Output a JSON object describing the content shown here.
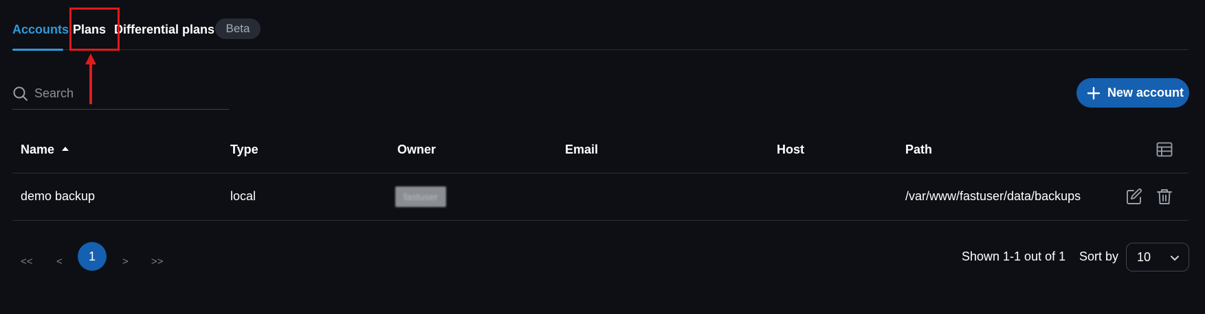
{
  "tabs": [
    {
      "label": "Accounts",
      "active": true
    },
    {
      "label": "Plans",
      "active": false
    },
    {
      "label": "Differential plans",
      "active": false
    }
  ],
  "beta_badge": "Beta",
  "search": {
    "placeholder": "Search",
    "value": ""
  },
  "new_button": {
    "label": "New account",
    "icon": "plus-icon"
  },
  "table": {
    "columns": [
      "Name",
      "Type",
      "Owner",
      "Email",
      "Host",
      "Path"
    ],
    "sort_column": "Name",
    "sort_direction": "ascending",
    "rows": [
      {
        "name": "demo backup",
        "type": "local",
        "owner": "fastuser",
        "email": "",
        "host": "",
        "path": "/var/www/fastuser/data/backups"
      }
    ]
  },
  "pagination": {
    "first": "<<",
    "prev": "<",
    "current": "1",
    "next": ">",
    "last": ">>",
    "shown_text": "Shown 1-1 out of 1",
    "sort_by_label": "Sort by",
    "page_size": "10"
  },
  "colors": {
    "background": "#0d0f14",
    "accent": "#2f9bdc",
    "primary_button": "#1560b0",
    "annotation": "#e11b1b"
  },
  "icons": [
    "search-icon",
    "plus-icon",
    "sort-up-icon",
    "columns-table-icon",
    "edit-icon",
    "trash-icon",
    "chevron-down-icon"
  ]
}
